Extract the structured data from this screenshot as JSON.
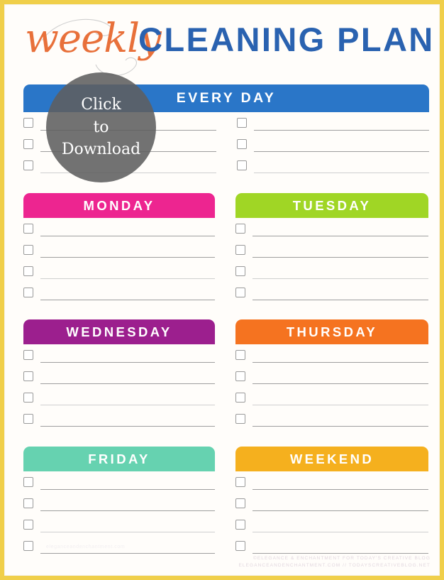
{
  "page": {
    "frame_color": "#f0cf4a",
    "background_color": "#fffdfa"
  },
  "title": {
    "script_word": "weekly",
    "script_color": "#e8703a",
    "main_words": "CLEANING PLAN",
    "main_color": "#2a62b0"
  },
  "overlay": {
    "line1": "Click",
    "line2": "to",
    "line3": "Download"
  },
  "sections": [
    {
      "id": "every-day",
      "label": "EVERY DAY",
      "color": "#2a76c8",
      "rows": 3,
      "full_width": true
    },
    {
      "id": "monday",
      "label": "MONDAY",
      "color": "#ed2590",
      "rows": 4,
      "full_width": false
    },
    {
      "id": "tuesday",
      "label": "TUESDAY",
      "color": "#a0d625",
      "rows": 4,
      "full_width": false
    },
    {
      "id": "wednesday",
      "label": "WEDNESDAY",
      "color": "#9c1f8e",
      "rows": 4,
      "full_width": false
    },
    {
      "id": "thursday",
      "label": "THURSDAY",
      "color": "#f57320",
      "rows": 4,
      "full_width": false
    },
    {
      "id": "friday",
      "label": "FRIDAY",
      "color": "#66d2b0",
      "rows": 4,
      "full_width": false
    },
    {
      "id": "weekend",
      "label": "WEEKEND",
      "color": "#f5b01e",
      "rows": 4,
      "full_width": false
    }
  ],
  "footer": {
    "line1": "©ELEGANCE & ENCHANTMENT FOR TODAY'S CREATIVE BLOG",
    "line2": "ELEGANCEANDENCHANTMENT.COM // TODAYSCREATIVEBLOG.NET"
  },
  "watermark": {
    "text": "eleganceandenchantment.com"
  }
}
